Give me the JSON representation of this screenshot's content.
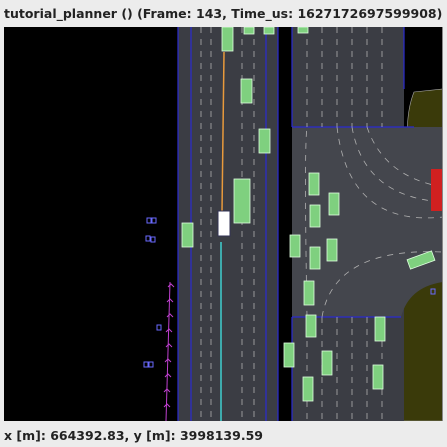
{
  "window": {
    "title": "tutorial_planner () (Frame: 143, Time_us: 1627172697599908)"
  },
  "status": {
    "cursor_coords": "x [m]: 664392.83, y [m]: 3998139.59"
  },
  "scene": {
    "colors": {
      "background": "#000000",
      "road_surface": "#3b3d44",
      "intersection_surface": "#44464d",
      "lane_border": "#2b2bd0",
      "lane_dash": "#b0b0b0",
      "vehicle": "#7fd07f",
      "ego_vehicle": "#ffffff",
      "planned_path": "#e89a3c",
      "reference_path": "#40d0d0",
      "curb": "#3a3a0a",
      "pedestrian": "#6a6aff",
      "trajectory_marker": "#c040d0",
      "traffic_light": "#d02020"
    }
  }
}
